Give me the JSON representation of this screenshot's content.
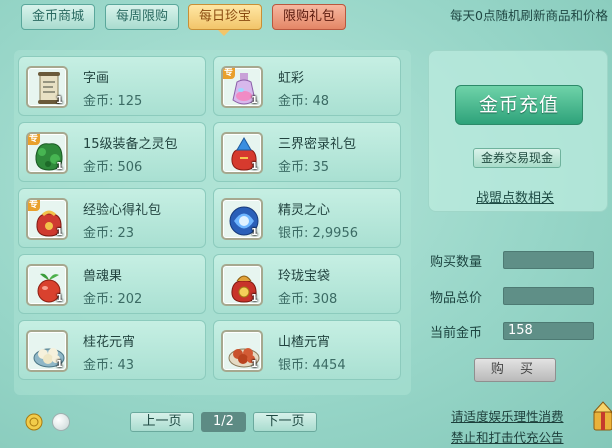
{
  "tabs": [
    {
      "label": "金币商城"
    },
    {
      "label": "每周限购"
    },
    {
      "label": "每日珍宝"
    },
    {
      "label": "限购礼包"
    }
  ],
  "notice": "每天0点随机刷新商品和价格",
  "items": [
    {
      "name": "字画",
      "price": "金币: 125",
      "qty": "1",
      "badge": "",
      "icon": "scroll-icon"
    },
    {
      "name": "虹彩",
      "price": "金币: 48",
      "qty": "1",
      "badge": "专",
      "icon": "potion-icon"
    },
    {
      "name": "15级装备之灵包",
      "price": "金币: 506",
      "qty": "1",
      "badge": "专",
      "icon": "green-pouch-icon"
    },
    {
      "name": "三界密录礼包",
      "price": "金币: 35",
      "qty": "1",
      "badge": "",
      "icon": "red-pouch-blue-icon"
    },
    {
      "name": "经验心得礼包",
      "price": "金币: 23",
      "qty": "1",
      "badge": "专",
      "icon": "red-pouch-icon"
    },
    {
      "name": "精灵之心",
      "price": "银币: 2,9956",
      "qty": "1",
      "badge": "",
      "icon": "spirit-heart-icon"
    },
    {
      "name": "兽魂果",
      "price": "金币: 202",
      "qty": "1",
      "badge": "",
      "icon": "fruit-icon"
    },
    {
      "name": "玲珑宝袋",
      "price": "金币: 308",
      "qty": "1",
      "badge": "",
      "icon": "treasure-bag-icon"
    },
    {
      "name": "桂花元宵",
      "price": "金币: 43",
      "qty": "1",
      "badge": "",
      "icon": "dumpling-white-icon"
    },
    {
      "name": "山楂元宵",
      "price": "银币: 4454",
      "qty": "1",
      "badge": "",
      "icon": "dumpling-red-icon"
    }
  ],
  "right": {
    "recharge": "金币充值",
    "exchange": "金券交易现金",
    "alliance_link": "战盟点数相关",
    "buy_qty_label": "购买数量",
    "buy_qty_value": "",
    "total_label": "物品总价",
    "total_value": "",
    "current_label": "当前金币",
    "current_value": "158",
    "buy": "购 买"
  },
  "pager": {
    "prev": "上一页",
    "indicator": "1/2",
    "next": "下一页"
  },
  "footer": {
    "line1": "请适度娱乐理性消费",
    "line2": "禁止和打击代充公告"
  },
  "colors": {
    "background": "#96d5c7",
    "tab_active": "#f2c56a",
    "tab_red": "#e48666",
    "recharge_button": "#2ea27a"
  }
}
